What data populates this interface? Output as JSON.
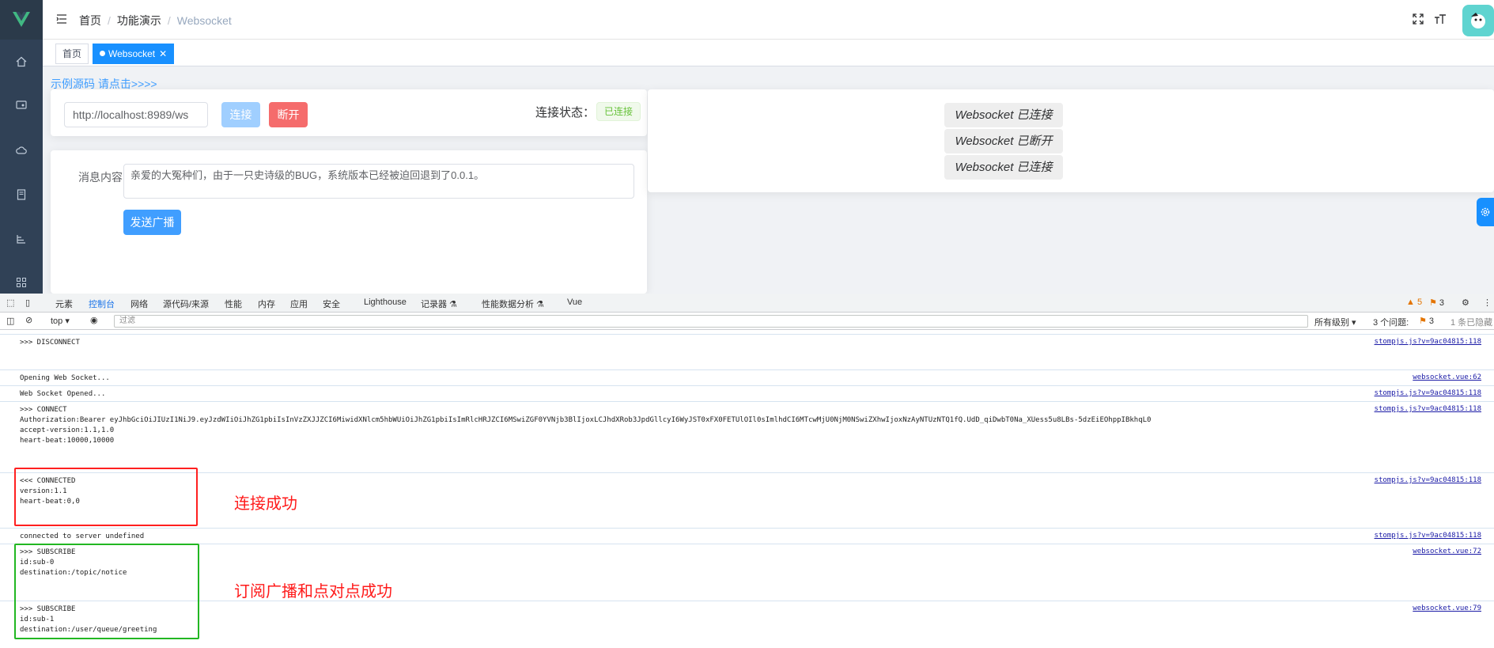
{
  "header": {
    "breadcrumb": [
      "首页",
      "功能演示",
      "Websocket"
    ],
    "separator": "/"
  },
  "tags": [
    {
      "label": "首页"
    },
    {
      "label": "Websocket"
    }
  ],
  "main": {
    "source_link": "示例源码 请点击>>>>",
    "url_input_value": "http://localhost:8989/ws",
    "connect_label": "连接",
    "disconnect_label": "断开",
    "status_label": "连接状态：",
    "status_value": "已连接",
    "message_label": "消息内容",
    "message_value": "亲爱的大冤种们，由于一只史诗级的BUG，系统版本已经被迫回退到了0.0.1。",
    "broadcast_label": "发送广播",
    "messages": [
      "Websocket 已连接",
      "Websocket 已断开",
      "Websocket 已连接"
    ]
  },
  "devtools": {
    "tabs": [
      "元素",
      "控制台",
      "网络",
      "源代码/来源",
      "性能",
      "内存",
      "应用",
      "安全",
      "Lighthouse",
      "记录器 ⚗",
      "性能数据分析 ⚗",
      "Vue"
    ],
    "active_tab": "控制台",
    "warn_count": "5",
    "issue_count": "3",
    "context": "top",
    "filter_placeholder": "过滤",
    "level": "所有级别 ▾",
    "issues_label": "3 个问题:",
    "issues_num": "3",
    "hidden": "1 条已隐藏"
  },
  "console": [
    {
      "text": ">>> DISCONNECT",
      "source": "stompjs.js?v=9ac04815:118"
    },
    {
      "text": "Opening Web Socket...",
      "source": "websocket.vue:62"
    },
    {
      "text": "Web Socket Opened...",
      "source": "stompjs.js?v=9ac04815:118"
    },
    {
      "text": ">>> CONNECT\nAuthorization:Bearer eyJhbGciOiJIUzI1NiJ9.eyJzdWIiOiJhZG1pbiIsInVzZXJJZCI6MiwidXNlcm5hbWUiOiJhZG1pbiIsImRlcHRJZCI6MSwiZGF0YVNjb3BlIjoxLCJhdXRob3JpdGllcyI6WyJST0xFX0FETUlOIl0sImlhdCI6MTcwMjU0NjM0NSwiZXhwIjoxNzAyNTUzNTQ1fQ.UdD_qiDwbT0Na_XUess5u8LBs-5dzEiEOhppIBkhqL0\naccept-version:1.1,1.0\nheart-beat:10000,10000",
      "source": "stompjs.js?v=9ac04815:118"
    },
    {
      "text": "<<< CONNECTED\nversion:1.1\nheart-beat:0,0",
      "source": "stompjs.js?v=9ac04815:118"
    },
    {
      "text": "connected to server undefined",
      "source": "stompjs.js?v=9ac04815:118"
    },
    {
      "text": ">>> SUBSCRIBE\nid:sub-0\ndestination:/topic/notice",
      "source": "websocket.vue:72"
    },
    {
      "text": ">>> SUBSCRIBE\nid:sub-1\ndestination:/user/queue/greeting",
      "source": "websocket.vue:79"
    }
  ],
  "annotations": {
    "connected": "连接成功",
    "subscribed": "订阅广播和点对点成功"
  }
}
